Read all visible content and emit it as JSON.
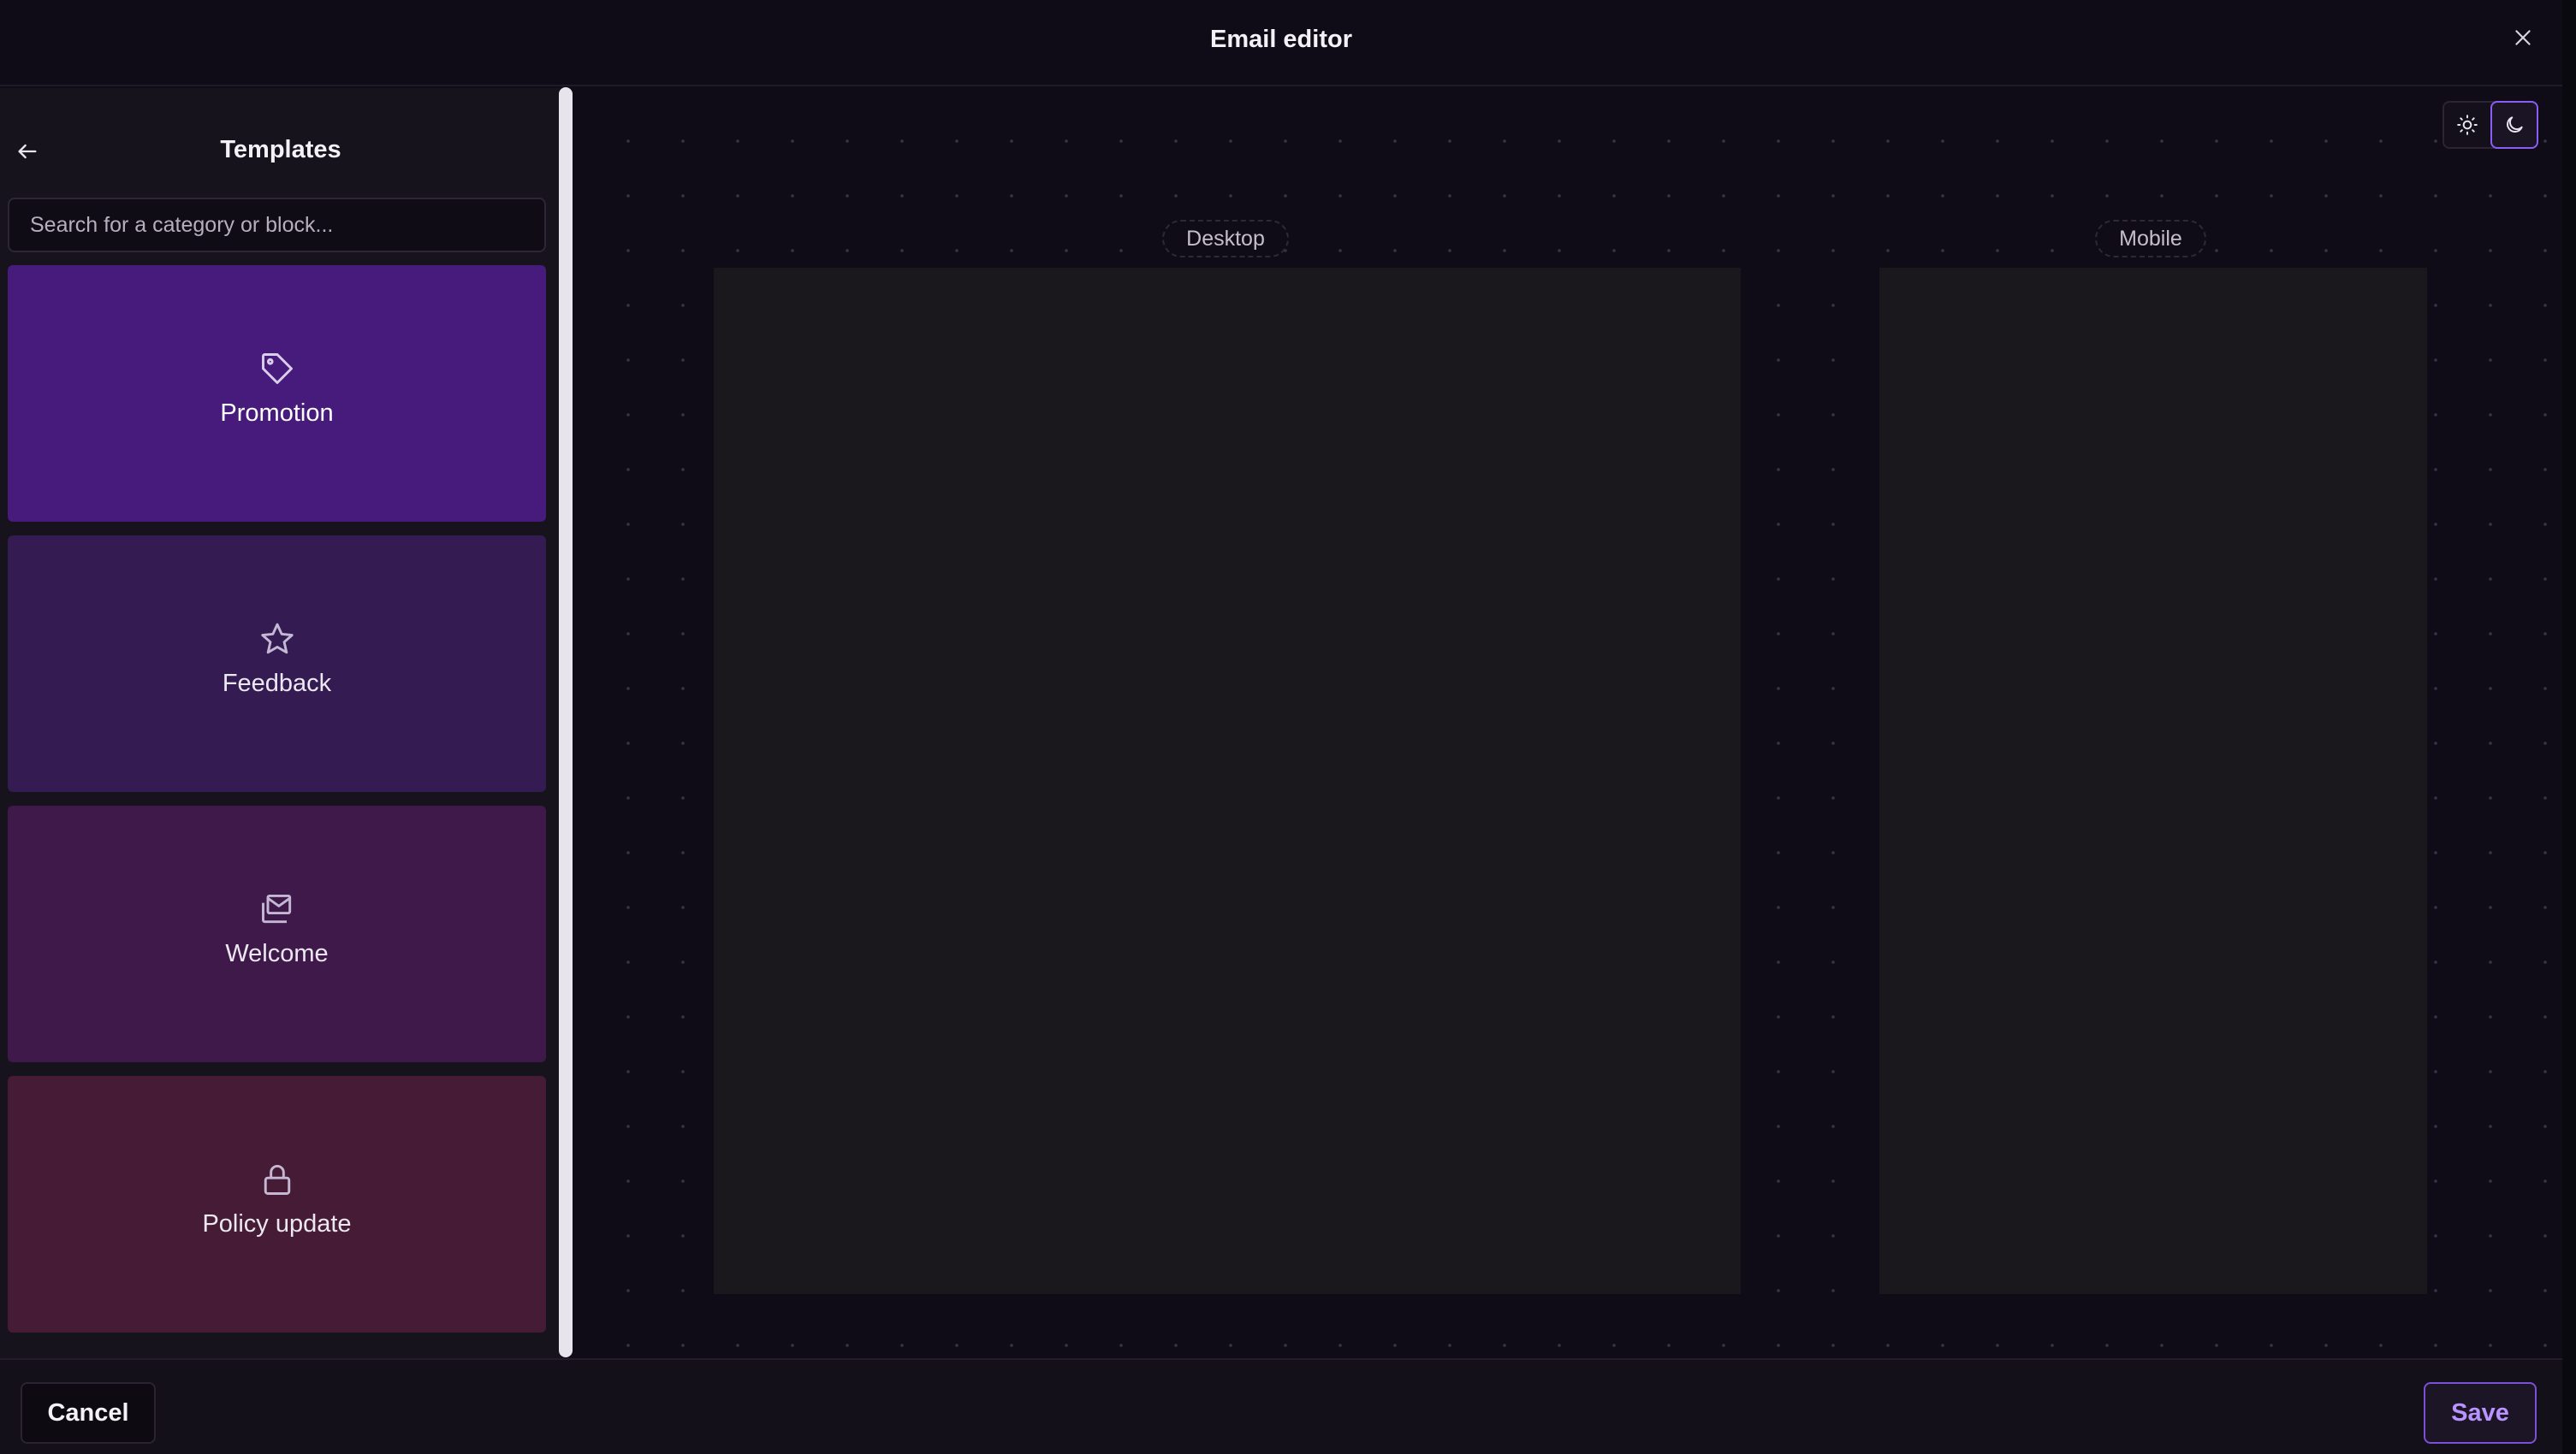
{
  "header": {
    "title": "Email editor",
    "close_icon": "close-icon"
  },
  "sidebar": {
    "title": "Templates",
    "back_icon": "arrow-left-icon",
    "search": {
      "placeholder": "Search for a category or block...",
      "value": ""
    },
    "templates": [
      {
        "label": "Promotion",
        "icon": "tag-icon",
        "color": "#461b7c"
      },
      {
        "label": "Feedback",
        "icon": "star-icon",
        "color": "#341b52"
      },
      {
        "label": "Welcome",
        "icon": "mail-open-icon",
        "color": "#3f1949"
      },
      {
        "label": "Policy update",
        "icon": "lock-icon",
        "color": "#451b35"
      }
    ]
  },
  "canvas": {
    "theme_toggle": {
      "light_icon": "sun-icon",
      "dark_icon": "moon-icon",
      "selected": "dark"
    },
    "previews": [
      {
        "label": "Desktop"
      },
      {
        "label": "Mobile"
      }
    ]
  },
  "footer": {
    "cancel_label": "Cancel",
    "save_label": "Save"
  }
}
